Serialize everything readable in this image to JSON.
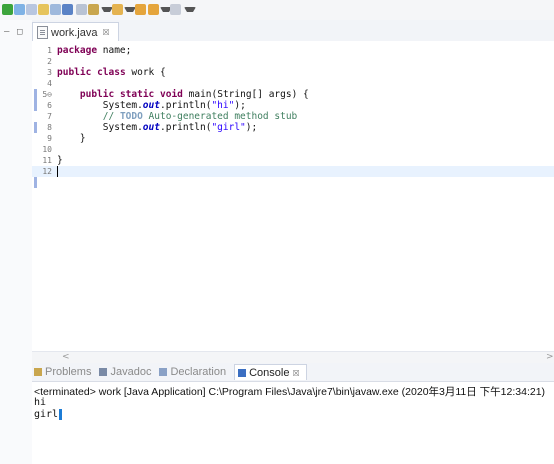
{
  "colors": {
    "keyword": "#7f0055",
    "comment": "#3f7f5f",
    "string": "#2a00ff",
    "field": "#0000c0",
    "line_number": "#787878",
    "selection_accent": "#1c7cd6"
  },
  "toolbar": {
    "icons": [
      "run-icon",
      "debug-icon",
      "search-icon",
      "new-icon",
      "open-icon",
      "save-icon",
      "pen-icon",
      "back-icon",
      "forward-icon",
      "dropdown-icon"
    ]
  },
  "left_strip": {
    "minimize": "—",
    "maximize": "□"
  },
  "editor": {
    "tab": {
      "label": "work.java",
      "close": "☒"
    },
    "lines": [
      {
        "num": "1",
        "segments": [
          {
            "t": "package",
            "c": "kw"
          },
          {
            "t": " name;",
            "c": ""
          }
        ]
      },
      {
        "num": "2",
        "segments": []
      },
      {
        "num": "3",
        "segments": [
          {
            "t": "public",
            "c": "kw"
          },
          {
            "t": " ",
            "c": ""
          },
          {
            "t": "class",
            "c": "kw"
          },
          {
            "t": " work {",
            "c": ""
          }
        ]
      },
      {
        "num": "4",
        "segments": []
      },
      {
        "num": "5⊖",
        "segments": [
          {
            "t": "    ",
            "c": ""
          },
          {
            "t": "public",
            "c": "kw"
          },
          {
            "t": " ",
            "c": ""
          },
          {
            "t": "static",
            "c": "kw"
          },
          {
            "t": " ",
            "c": ""
          },
          {
            "t": "void",
            "c": "kw"
          },
          {
            "t": " main(String[] args) {",
            "c": ""
          }
        ]
      },
      {
        "num": "6",
        "segments": [
          {
            "t": "        System.",
            "c": ""
          },
          {
            "t": "out",
            "c": "fd"
          },
          {
            "t": ".println(",
            "c": ""
          },
          {
            "t": "\"hi\"",
            "c": "st"
          },
          {
            "t": ");",
            "c": ""
          }
        ]
      },
      {
        "num": "7",
        "segments": [
          {
            "t": "        ",
            "c": ""
          },
          {
            "t": "// ",
            "c": "cm"
          },
          {
            "t": "TODO",
            "c": "todo"
          },
          {
            "t": " Auto-generated method stub",
            "c": "cm"
          }
        ]
      },
      {
        "num": "8",
        "segments": [
          {
            "t": "        System.",
            "c": ""
          },
          {
            "t": "out",
            "c": "fd"
          },
          {
            "t": ".println(",
            "c": ""
          },
          {
            "t": "\"girl\"",
            "c": "st"
          },
          {
            "t": ");",
            "c": ""
          }
        ]
      },
      {
        "num": "9",
        "segments": [
          {
            "t": "    }",
            "c": ""
          }
        ]
      },
      {
        "num": "10",
        "segments": []
      },
      {
        "num": "11",
        "segments": [
          {
            "t": "}",
            "c": ""
          }
        ]
      },
      {
        "num": "12",
        "segments": []
      }
    ],
    "current_line": 12,
    "scroll_left": "<",
    "scroll_right": ">"
  },
  "views": {
    "tabs": [
      {
        "label": "Problems",
        "icon": "problems-icon",
        "active": false
      },
      {
        "label": "Javadoc",
        "icon": "javadoc-icon",
        "active": false
      },
      {
        "label": "Declaration",
        "icon": "declaration-icon",
        "active": false
      },
      {
        "label": "Console",
        "icon": "console-icon",
        "active": true
      }
    ],
    "close": "☒"
  },
  "console": {
    "header": "<terminated> work [Java Application] C:\\Program Files\\Java\\jre7\\bin\\javaw.exe (2020年3月11日 下午12:34:21)",
    "output": [
      "hi",
      "girl"
    ]
  }
}
